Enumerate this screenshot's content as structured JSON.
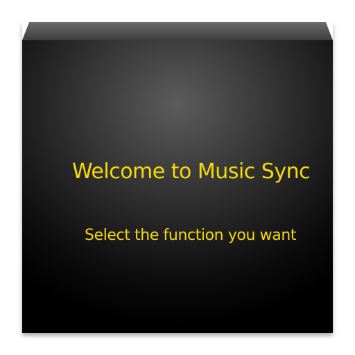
{
  "app_icon": {
    "title": "Welcome to Music Sync",
    "subtitle": "Select the function you want",
    "text_color": "#f5d90a"
  }
}
